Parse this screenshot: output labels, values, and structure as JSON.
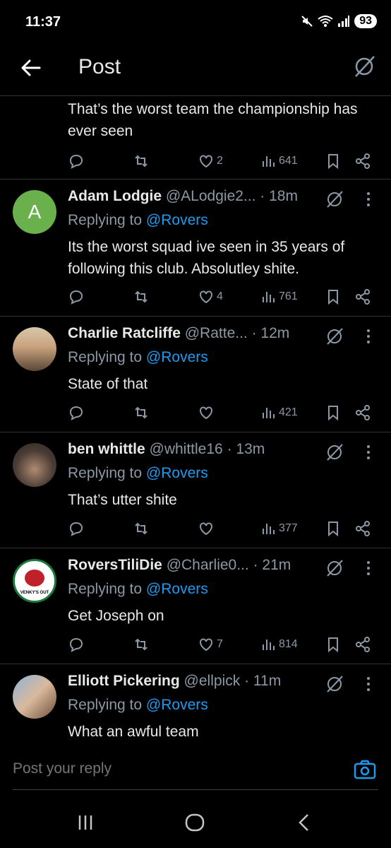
{
  "status": {
    "time": "11:37",
    "battery": "93"
  },
  "header": {
    "title": "Post"
  },
  "first_reply": {
    "text": "That’s the worst team the championship has ever seen",
    "likes": "2",
    "views": "641"
  },
  "replies": [
    {
      "name": "Adam Lodgie",
      "handle": "@ALodgie2...",
      "time": "· 18m",
      "replying_prefix": "Replying to",
      "mention": "@Rovers",
      "text": "Its the worst squad ive seen in 35 years of following this club. Absolutley shite.",
      "likes": "4",
      "views": "761",
      "avatar_letter": "A"
    },
    {
      "name": "Charlie Ratcliffe",
      "handle": "@Ratte...",
      "time": "· 12m",
      "replying_prefix": "Replying to",
      "mention": "@Rovers",
      "text": "State of that",
      "likes": "",
      "views": "421"
    },
    {
      "name": "ben whittle",
      "handle": "@whittle16",
      "time": "· 13m",
      "replying_prefix": "Replying to",
      "mention": "@Rovers",
      "text": "That’s utter shite",
      "likes": "",
      "views": "377"
    },
    {
      "name": "RoversTiliDie",
      "handle": "@Charlie0...",
      "time": "· 21m",
      "replying_prefix": "Replying to",
      "mention": "@Rovers",
      "text": "Get Joseph on",
      "likes": "7",
      "views": "814",
      "avatar_text": "VENKY'S OUT"
    },
    {
      "name": "Elliott Pickering",
      "handle": "@ellpick",
      "time": "· 11m",
      "replying_prefix": "Replying to",
      "mention": "@Rovers",
      "text": "What an awful team"
    }
  ],
  "composer": {
    "placeholder": "Post your reply"
  },
  "colors": {
    "background": "#000000",
    "accent": "#1d9bf0",
    "muted": "#8b98a5",
    "divider": "#2f3336"
  }
}
